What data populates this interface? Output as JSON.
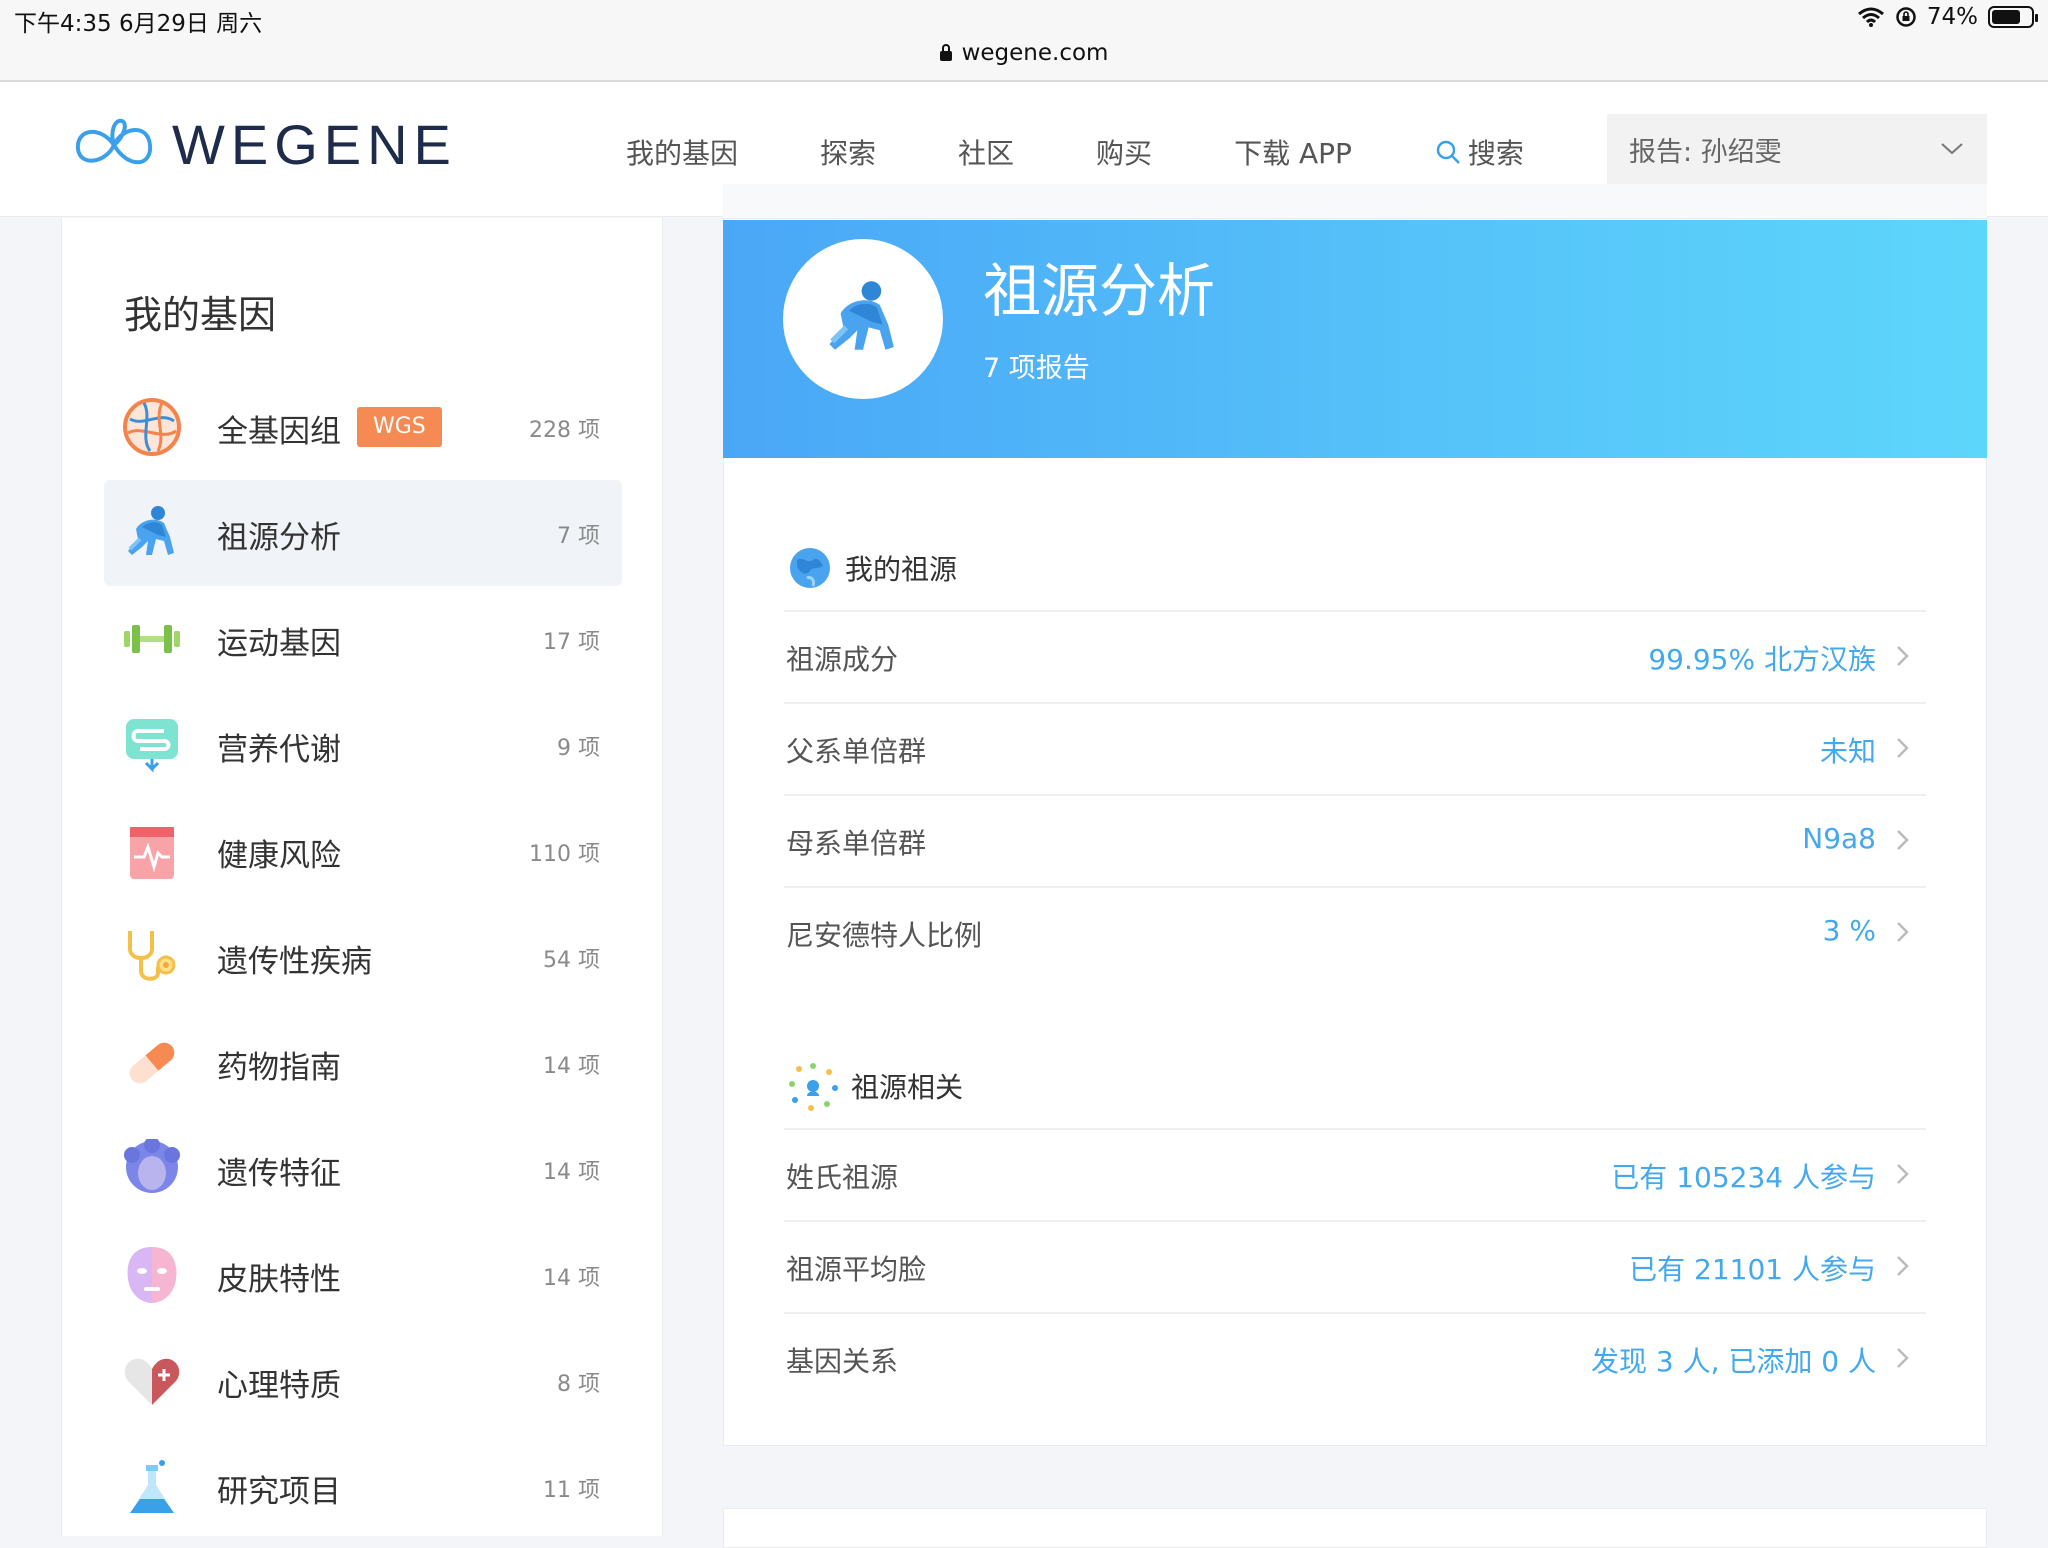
{
  "status_bar": {
    "time": "下午4:35   6月29日 周六",
    "battery": "74%",
    "battery_level": 0.74,
    "url": "wegene.com"
  },
  "header": {
    "logo_text": "WEGENE",
    "nav": [
      "我的基因",
      "探索",
      "社区",
      "购买",
      "下载 APP"
    ],
    "search_label": "搜索",
    "report_select": "报告: 孙绍雯"
  },
  "sidebar": {
    "title": "我的基因",
    "wgs_badge": "WGS",
    "items": [
      {
        "label": "全基因组",
        "count": "228 项",
        "icon": "genome-icon"
      },
      {
        "label": "祖源分析",
        "count": "7 项",
        "icon": "ancestry-ape-icon"
      },
      {
        "label": "运动基因",
        "count": "17 项",
        "icon": "dumbbell-icon"
      },
      {
        "label": "营养代谢",
        "count": "9 项",
        "icon": "nutrition-icon"
      },
      {
        "label": "健康风险",
        "count": "110 项",
        "icon": "health-risk-icon"
      },
      {
        "label": "遗传性疾病",
        "count": "54 项",
        "icon": "stethoscope-icon"
      },
      {
        "label": "药物指南",
        "count": "14 项",
        "icon": "pill-icon"
      },
      {
        "label": "遗传特征",
        "count": "14 项",
        "icon": "curly-hair-icon"
      },
      {
        "label": "皮肤特性",
        "count": "14 项",
        "icon": "face-mask-icon"
      },
      {
        "label": "心理特质",
        "count": "8 项",
        "icon": "heart-icon"
      },
      {
        "label": "研究项目",
        "count": "11 项",
        "icon": "flask-icon"
      }
    ]
  },
  "banner": {
    "title": "祖源分析",
    "subtitle": "7 项报告"
  },
  "sections": [
    {
      "title": "我的祖源",
      "icon": "globe-icon",
      "rows": [
        {
          "label": "祖源成分",
          "value": "99.95% 北方汉族"
        },
        {
          "label": "父系单倍群",
          "value": "未知"
        },
        {
          "label": "母系单倍群",
          "value": "N9a8"
        },
        {
          "label": "尼安德特人比例",
          "value": "3 %"
        }
      ]
    },
    {
      "title": "祖源相关",
      "icon": "network-icon",
      "rows": [
        {
          "label": "姓氏祖源",
          "value": "已有 105234 人参与"
        },
        {
          "label": "祖源平均脸",
          "value": "已有 21101 人参与"
        },
        {
          "label": "基因关系",
          "value": "发现 3 人, 已添加 0 人"
        }
      ]
    }
  ],
  "colors": {
    "accent": "#43a8ee",
    "banner_start": "#4aa7f7",
    "banner_end": "#5dd6fb",
    "wgs_badge": "#f58a52"
  }
}
